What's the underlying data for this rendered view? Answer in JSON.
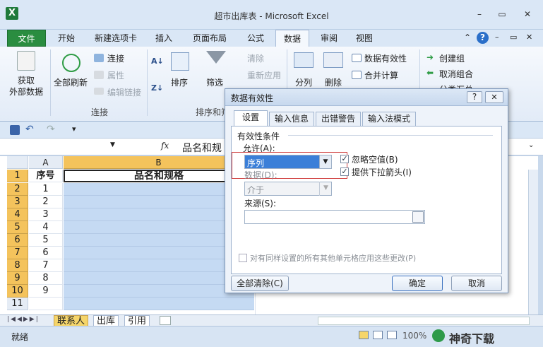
{
  "window": {
    "title": "超市出库表 - Microsoft Excel",
    "app_icon": "X",
    "minimize": "–",
    "restore": "▭",
    "close": "✕"
  },
  "ribbon_tabs": [
    "文件",
    "开始",
    "新建选项卡",
    "插入",
    "页面布局",
    "公式",
    "数据",
    "审阅",
    "视图"
  ],
  "ribbon_right": {
    "minimize_ribbon": "⌃",
    "help": "?",
    "min": "–",
    "restore": "▭",
    "close": "✕"
  },
  "ribbon": {
    "get_external": "获取\n外部数据",
    "refresh_all": "全部刷新",
    "connections": "连接",
    "properties": "属性",
    "edit_links": "编辑链接",
    "group_connections": "连接",
    "sort": "排序",
    "filter": "筛选",
    "clear": "清除",
    "reapply": "重新应用",
    "group_sort": "排序和筛选",
    "text_to_columns": "分列",
    "remove_dup": "删除",
    "data_validation": "数据有效性",
    "consolidate": "合并计算",
    "group": "创建组",
    "ungroup": "取消组合",
    "subtotal": "分类汇总"
  },
  "namebox": "B1",
  "formula": "品名和规",
  "fx": "fx",
  "columns": [
    "A",
    "B"
  ],
  "rows": [
    {
      "n": "1",
      "a": "序号"
    },
    {
      "n": "2",
      "a": "1"
    },
    {
      "n": "3",
      "a": "2"
    },
    {
      "n": "4",
      "a": "3"
    },
    {
      "n": "5",
      "a": "4"
    },
    {
      "n": "6",
      "a": "5"
    },
    {
      "n": "7",
      "a": "6"
    },
    {
      "n": "8",
      "a": "7"
    },
    {
      "n": "9",
      "a": "8"
    },
    {
      "n": "10",
      "a": "9"
    },
    {
      "n": "11",
      "a": ""
    }
  ],
  "b1_header": "品名和规格",
  "sheets": [
    "联系人",
    "出库",
    "引用"
  ],
  "status": "就绪",
  "zoom": "100%",
  "watermark": "神奇下载",
  "dialog": {
    "title": "数据有效性",
    "help": "?",
    "close": "✕",
    "tabs": [
      "设置",
      "输入信息",
      "出错警告",
      "输入法模式"
    ],
    "section": "有效性条件",
    "allow_label": "允许(A):",
    "allow_value": "序列",
    "data_label": "数据(D):",
    "data_value": "介于",
    "ignore_blank": "忽略空值(B)",
    "dropdown": "提供下拉箭头(I)",
    "source_label": "来源(S):",
    "source_value": "",
    "apply_all": "对有同样设置的所有其他单元格应用这些更改(P)",
    "clear_all": "全部清除(C)",
    "ok": "确定",
    "cancel": "取消"
  }
}
